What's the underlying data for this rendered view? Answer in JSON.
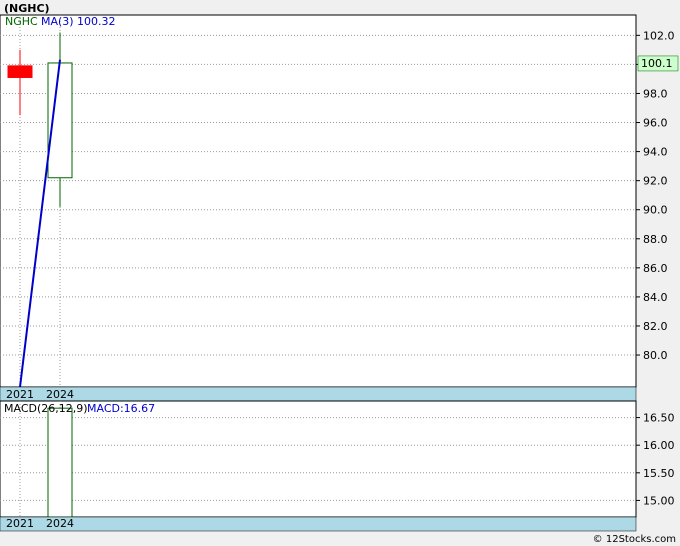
{
  "title": "(NGHC)",
  "watermark": "© 12Stocks.com",
  "chart_data": [
    {
      "type": "candlestick",
      "ticker_label": "NGHC",
      "ma_label": "MA(3)",
      "ma_value_label": "100.32",
      "last_price_label": "100.1",
      "x_categories": [
        "2021",
        "2024"
      ],
      "ylim": [
        77.8,
        103.4
      ],
      "y_ticks": [
        80.0,
        82.0,
        84.0,
        86.0,
        88.0,
        90.0,
        92.0,
        94.0,
        96.0,
        98.0,
        100.0,
        102.0
      ],
      "y_tick_labels": [
        "80.0",
        "82.0",
        "84.0",
        "86.0",
        "88.0",
        "90.0",
        "92.0",
        "94.0",
        "96.0",
        "98.0",
        "100.0",
        "102.0"
      ],
      "grid": true,
      "candles": [
        {
          "x": "2021",
          "open": 99.9,
          "high": 101.0,
          "low": 96.5,
          "close": 99.1
        },
        {
          "x": "2024",
          "open": 92.2,
          "high": 102.2,
          "low": 90.2,
          "close": 100.1
        }
      ],
      "ma_series": [
        {
          "x": "2021",
          "value": 77.8
        },
        {
          "x": "2024",
          "value": 100.32
        }
      ],
      "colors": {
        "up": "#006400",
        "down": "#ff0000",
        "ma": "#0000cc",
        "last_price_bg": "#ccffcc"
      }
    },
    {
      "type": "bar",
      "label": "MACD(26,12,9)",
      "value_label": "MACD:16.67",
      "x_categories": [
        "2021",
        "2024"
      ],
      "ylim": [
        14.7,
        16.8
      ],
      "y_ticks": [
        15.0,
        15.5,
        16.0,
        16.5
      ],
      "y_tick_labels": [
        "15.00",
        "15.50",
        "16.00",
        "16.50"
      ],
      "grid": true,
      "bars": [
        {
          "x": "2024",
          "value": 16.67
        }
      ],
      "colors": {
        "bar": "#006400"
      }
    }
  ]
}
